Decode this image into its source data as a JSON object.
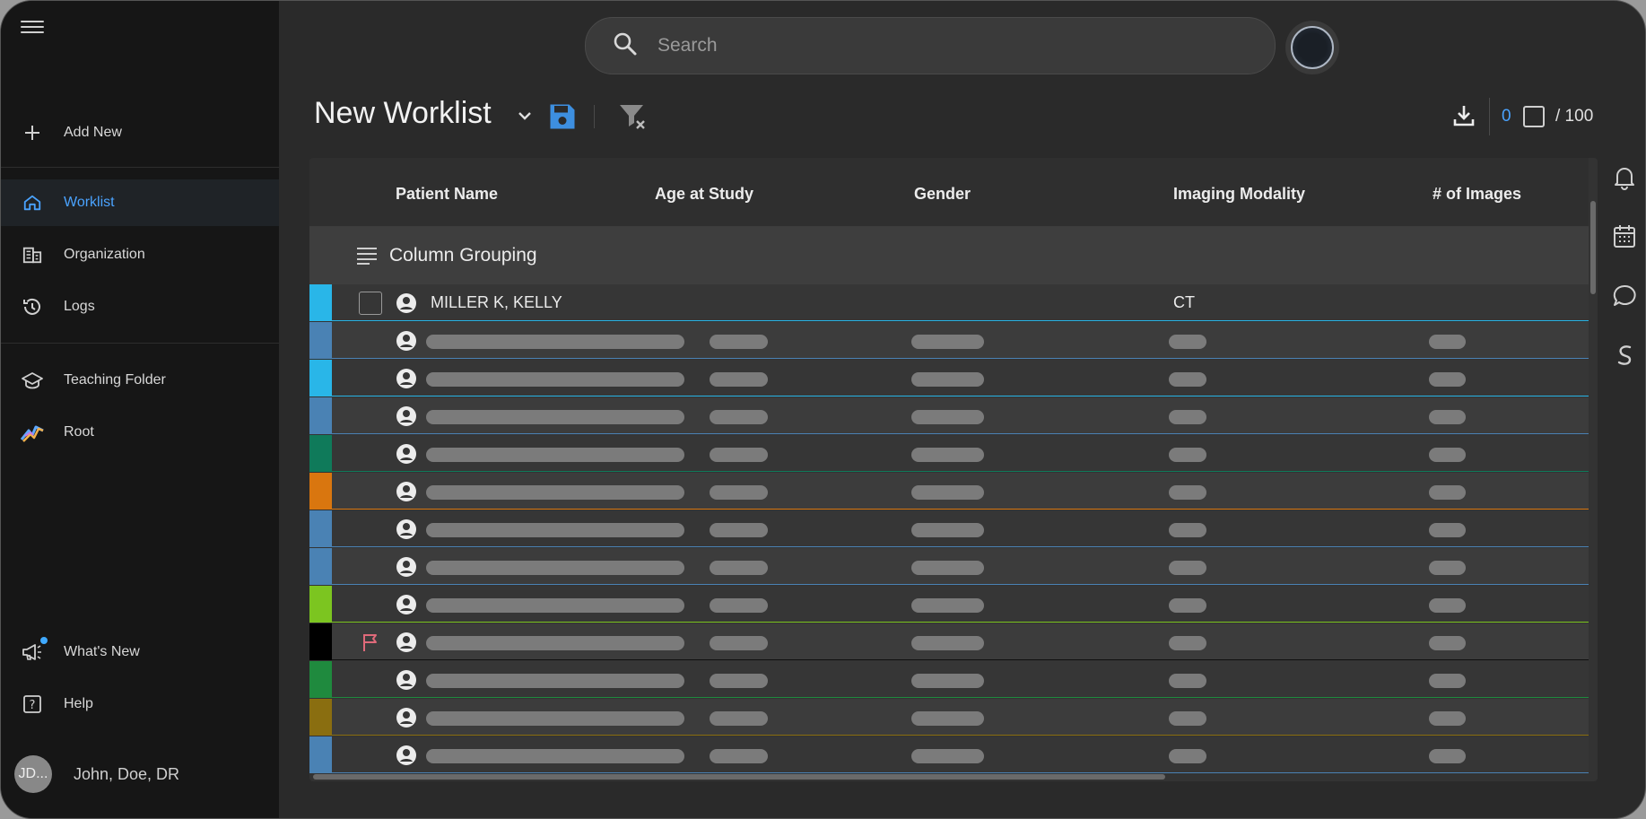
{
  "sidebar": {
    "add_new": "Add New",
    "items": [
      {
        "label": "Worklist",
        "icon": "home-icon"
      },
      {
        "label": "Organization",
        "icon": "organization-icon"
      },
      {
        "label": "Logs",
        "icon": "history-icon"
      },
      {
        "label": "Teaching Folder",
        "icon": "graduation-cap-icon"
      },
      {
        "label": "Root",
        "icon": "root-logo-icon"
      }
    ],
    "whats_new": "What's New",
    "help": "Help",
    "user_initials": "JD...",
    "user_name": "John, Doe, DR"
  },
  "search": {
    "placeholder": "Search"
  },
  "worklist": {
    "title": "New Worklist",
    "selected_count": "0",
    "total_label": "/ 100"
  },
  "table": {
    "columns": [
      "Patient Name",
      "Age at Study",
      "Gender",
      "Imaging Modality",
      "# of Images"
    ],
    "group_label": "Column Grouping",
    "first_row": {
      "patient_name": "MILLER K, KELLY",
      "modality": "CT"
    },
    "rows": [
      {
        "color": "#29b6e8",
        "detailed": true,
        "flag": false
      },
      {
        "color": "#4a82b4",
        "detailed": false,
        "flag": false
      },
      {
        "color": "#29b6e8",
        "detailed": false,
        "flag": false
      },
      {
        "color": "#4a82b4",
        "detailed": false,
        "flag": false
      },
      {
        "color": "#0f7a5a",
        "detailed": false,
        "flag": false
      },
      {
        "color": "#d9760f",
        "detailed": false,
        "flag": false
      },
      {
        "color": "#4a82b4",
        "detailed": false,
        "flag": false
      },
      {
        "color": "#4a82b4",
        "detailed": false,
        "flag": false
      },
      {
        "color": "#7cc520",
        "detailed": false,
        "flag": false
      },
      {
        "color": "#000000",
        "detailed": false,
        "flag": true
      },
      {
        "color": "#1f8a3e",
        "detailed": false,
        "flag": false
      },
      {
        "color": "#8a6e10",
        "detailed": false,
        "flag": false
      },
      {
        "color": "#4a82b4",
        "detailed": false,
        "flag": false
      }
    ]
  },
  "colors": {
    "accent": "#4aa3ff",
    "save_icon": "#3d8fe0",
    "flag": "#e06a7a"
  }
}
